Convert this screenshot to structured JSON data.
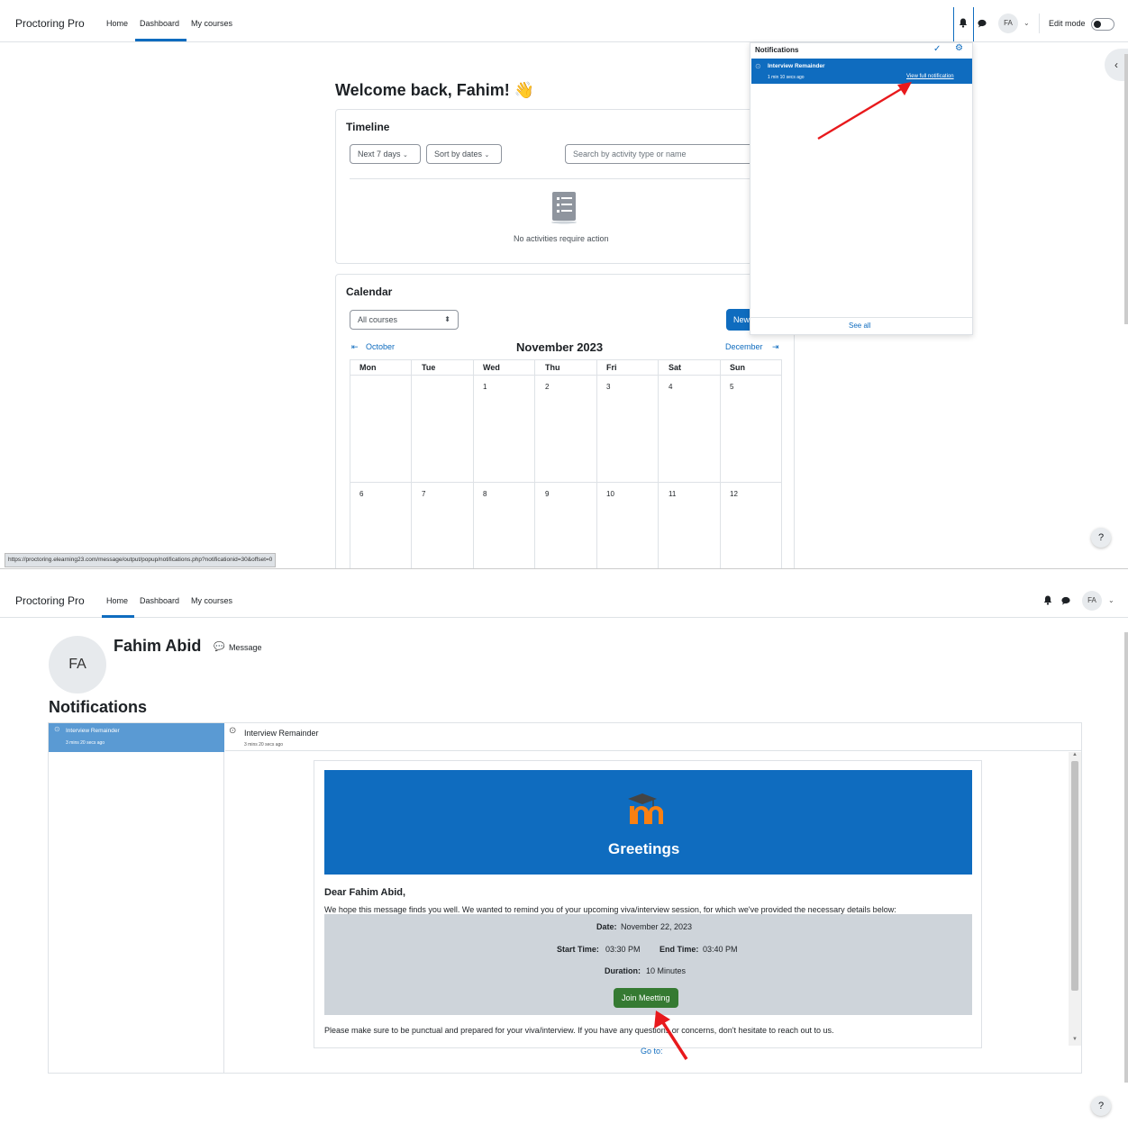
{
  "top": {
    "nav": {
      "brand": "Proctoring Pro",
      "links": [
        "Home",
        "Dashboard",
        "My courses"
      ],
      "avatar_initials": "FA",
      "edit_mode_label": "Edit mode"
    },
    "welcome": "Welcome back, Fahim! 👋",
    "timeline": {
      "title": "Timeline",
      "range_dropdown": "Next 7 days",
      "sort_dropdown": "Sort by dates",
      "search_placeholder": "Search by activity type or name",
      "empty_text": "No activities require action"
    },
    "calendar": {
      "title": "Calendar",
      "course_select": "All courses",
      "new_event_button": "New",
      "prev_month": "October",
      "month_label": "November 2023",
      "next_month": "December",
      "weekdays": [
        "Mon",
        "Tue",
        "Wed",
        "Thu",
        "Fri",
        "Sat",
        "Sun"
      ],
      "week1": [
        "",
        "",
        "1",
        "2",
        "3",
        "4",
        "5"
      ],
      "week2": [
        "6",
        "7",
        "8",
        "9",
        "10",
        "11",
        "12"
      ]
    },
    "notifications_popover": {
      "title": "Notifications",
      "item_title": "Interview Remainder",
      "item_time": "1 min 10 secs ago",
      "item_link": "View full notification",
      "see_all": "See all"
    },
    "status_url": "https://proctoring.elearning23.com/message/output/popup/notifications.php?notificationid=30&offset=0",
    "help_label": "?"
  },
  "bottom": {
    "nav": {
      "brand": "Proctoring Pro",
      "links": [
        "Home",
        "Dashboard",
        "My courses"
      ],
      "avatar_initials": "FA"
    },
    "profile": {
      "initials": "FA",
      "name": "Fahim Abid",
      "message_link": "Message"
    },
    "page_heading": "Notifications",
    "list_item": {
      "title": "Interview Remainder",
      "time": "3 mins 20 secs ago"
    },
    "detail": {
      "title": "Interview Remainder",
      "time": "3 mins 20 secs ago"
    },
    "email": {
      "banner_title": "Greetings",
      "salutation": "Dear Fahim Abid,",
      "intro": "We hope this message finds you well. We wanted to remind you of your upcoming viva/interview session, for which we've provided the necessary details below:",
      "date_label": "Date:",
      "date_value": "November 22, 2023",
      "start_label": "Start Time:",
      "start_value": "03:30 PM",
      "end_label": "End Time:",
      "end_value": "03:40 PM",
      "duration_label": "Duration:",
      "duration_value": "10 Minutes",
      "join_button": "Join Meetting",
      "closing": "Please make sure to be punctual and prepared for your viva/interview. If you have any questions or concerns, don't hesitate to reach out to us.",
      "goto_link": "Go to:"
    },
    "help_label": "?"
  },
  "colors": {
    "primary": "#0f6cbf",
    "join_green": "#357a32",
    "annotation_red": "#e8191c"
  }
}
